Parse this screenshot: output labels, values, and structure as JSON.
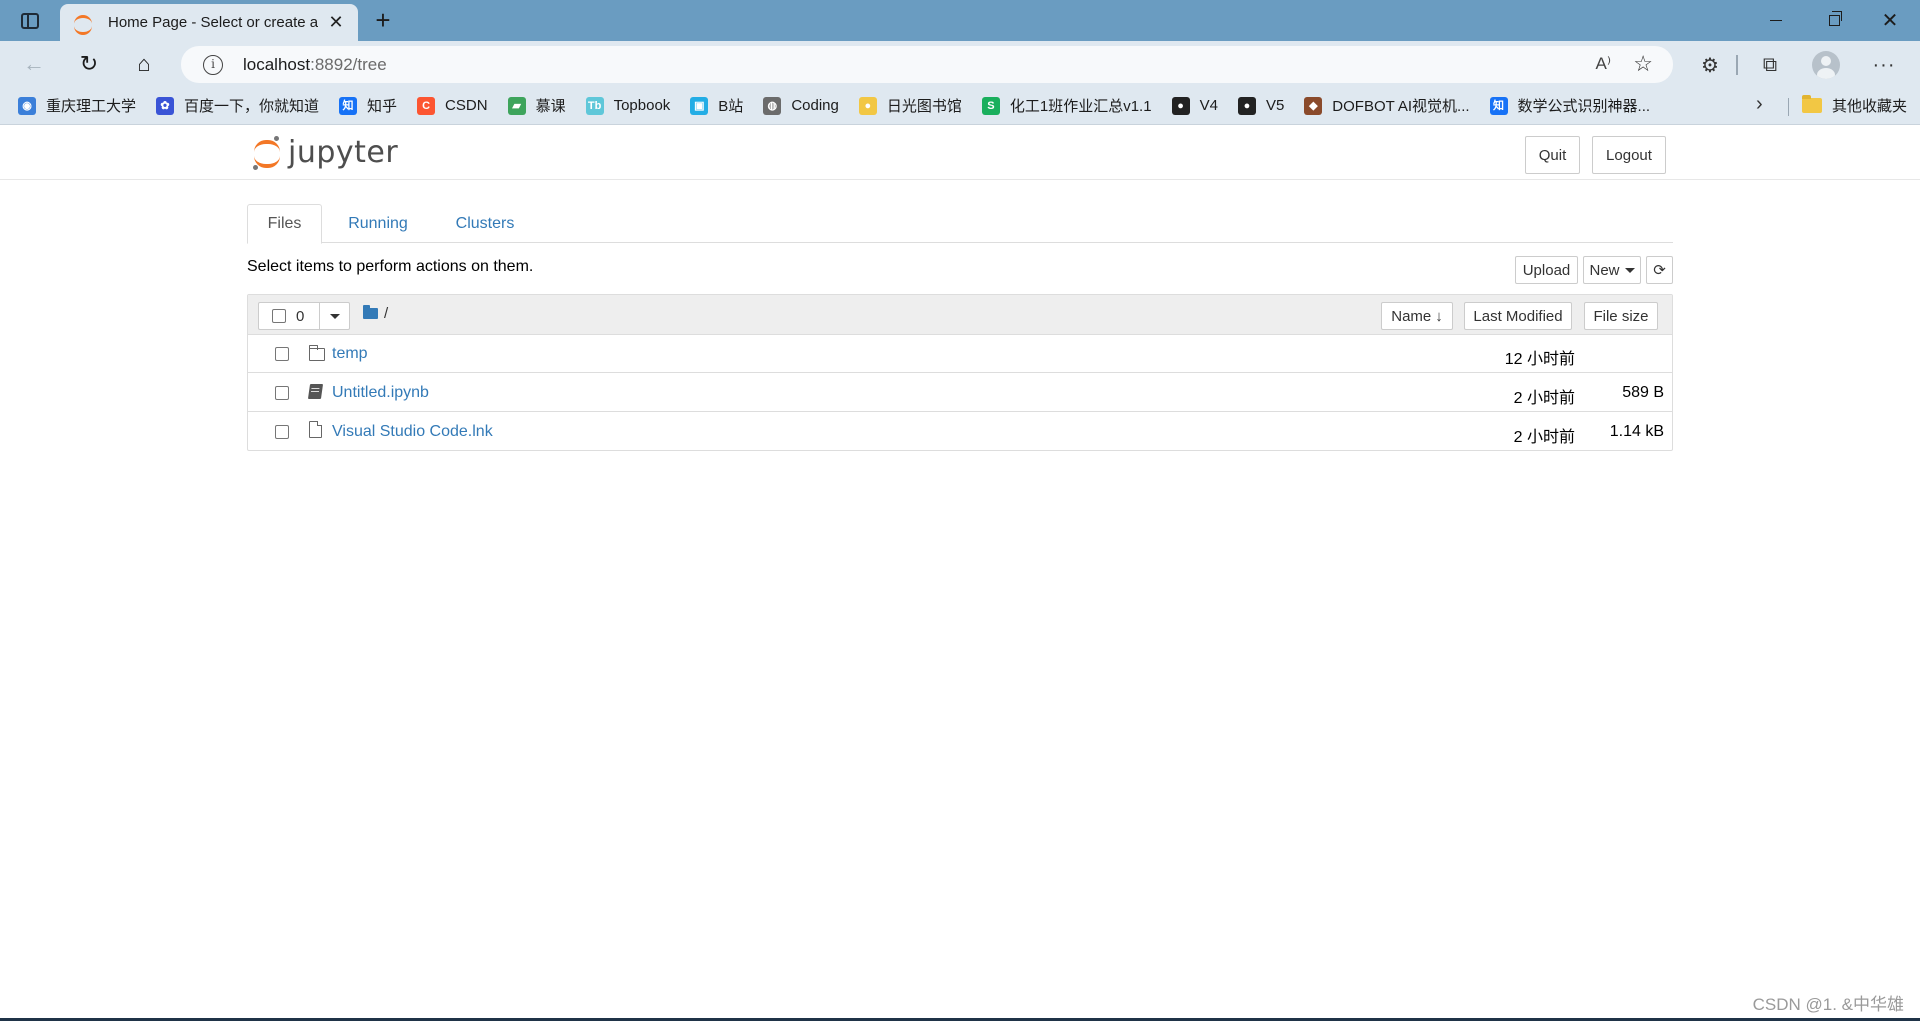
{
  "browser": {
    "tab_title": "Home Page - Select or create a n",
    "url_host": "localhost",
    "url_rest": ":8892/tree",
    "bookmarks": [
      {
        "label": "重庆理工大学",
        "icon": "globe-icon",
        "color": "#3b7fd9"
      },
      {
        "label": "百度一下，你就知道",
        "icon": "baidu-icon",
        "color": "#3a54d6"
      },
      {
        "label": "知乎",
        "icon": "zhihu-icon",
        "color": "#1772f6"
      },
      {
        "label": "CSDN",
        "icon": "csdn-icon",
        "color": "#fc5531"
      },
      {
        "label": "慕课",
        "icon": "mooc-icon",
        "color": "#3ea45c"
      },
      {
        "label": "Topbook",
        "icon": "topbook-icon",
        "color": "#5fc7d9"
      },
      {
        "label": "B站",
        "icon": "bilibili-icon",
        "color": "#23ade5"
      },
      {
        "label": "Coding",
        "icon": "coding-icon",
        "color": "#6b6b6b"
      },
      {
        "label": "日光图书馆",
        "icon": "sun-icon",
        "color": "#f2c744"
      },
      {
        "label": "化工1班作业汇总v1.1",
        "icon": "sheet-icon",
        "color": "#1aaf5d"
      },
      {
        "label": "V4",
        "icon": "github-icon",
        "color": "#222222"
      },
      {
        "label": "V5",
        "icon": "github-icon",
        "color": "#222222"
      },
      {
        "label": "DOFBOT AI视觉机...",
        "icon": "dofbot-icon",
        "color": "#8a4a2b"
      },
      {
        "label": "数学公式识别神器...",
        "icon": "zhihu-icon",
        "color": "#1772f6"
      }
    ],
    "other_bookmarks": "其他收藏夹"
  },
  "jupyter": {
    "wordmark": "jupyter",
    "quit_label": "Quit",
    "logout_label": "Logout",
    "tabs": {
      "files": "Files",
      "running": "Running",
      "clusters": "Clusters"
    },
    "hint": "Select items to perform actions on them.",
    "upload_label": "Upload",
    "new_label": "New",
    "selected_count": "0",
    "breadcrumb": "/",
    "sort": {
      "name": "Name",
      "modified": "Last Modified",
      "size": "File size"
    },
    "files": [
      {
        "name": "temp",
        "type": "folder",
        "modified": "12 小时前",
        "size": ""
      },
      {
        "name": "Untitled.ipynb",
        "type": "notebook",
        "modified": "2 小时前",
        "size": "589 B"
      },
      {
        "name": "Visual Studio Code.lnk",
        "type": "file",
        "modified": "2 小时前",
        "size": "1.14 kB"
      }
    ]
  },
  "watermark": "CSDN @1. &中华雄",
  "colors": {
    "link": "#337ab7",
    "jupyter_orange": "#f37726",
    "chrome_blue": "#6a9cc1"
  }
}
